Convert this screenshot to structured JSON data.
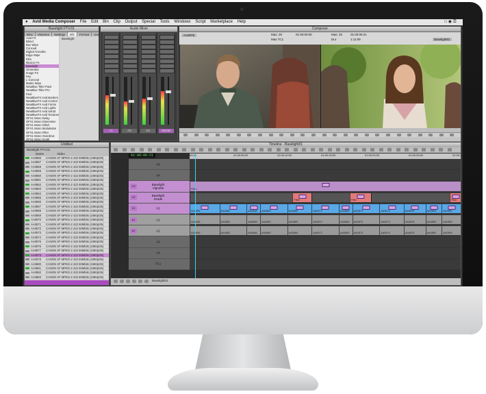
{
  "menubar": {
    "apple": "",
    "app": "Avid Media Composer",
    "items": [
      "File",
      "Edit",
      "Bin",
      "Clip",
      "Output",
      "Special",
      "Tools",
      "Windows",
      "Script",
      "Marketplace",
      "Help"
    ]
  },
  "effect_palette": {
    "title": "Baselight FTV.01",
    "tabs": [
      "Bins",
      "Volumes",
      "Settings",
      "Efx",
      "Format",
      "Usage",
      "Info"
    ],
    "active_tab": "Efx",
    "categories": [
      "Avid FX",
      "Blend",
      "Box Wipe",
      "Conceal",
      "Digital Arenafec",
      "Edge Wipe",
      "Film",
      "Illusion FX",
      "Baselight",
      "Generator",
      "Image FX",
      "Key",
      "L-Conceal",
      "Matrix Wipe",
      "NewBlue Titler Pack",
      "NewBlue Titler Pro",
      "Peel",
      "NewBlueFX Avid Borders",
      "NewBlueFX Avid Control",
      "NewBlueFX Avid Forms",
      "NewBlueFX Avid Lights",
      "NewBlueFX Avid Sarsd",
      "NewBlueFX Avid Textures",
      "OFX1 Mono Delay",
      "OFX1 Mono Dimension",
      "OFX1 Mono Glitch",
      "OFX1 Mono Modulation",
      "OFX1 Mono Filter",
      "OFX1 Mono Overdrive",
      "OFX1 Mono Synth"
    ],
    "selected_index": 8,
    "detail_item": "Baselight"
  },
  "audio_mixer": {
    "title": "Audio Mixer",
    "channels": [
      {
        "label": "A1",
        "level": 0.62,
        "highlight": true
      },
      {
        "label": "A2",
        "level": 0.48,
        "highlight": false
      },
      {
        "label": "A3",
        "level": 0.55,
        "highlight": false
      },
      {
        "label": "Master",
        "level": 0.7,
        "highlight": true
      }
    ],
    "top_value": "-INF"
  },
  "composer": {
    "title": "Composer",
    "source_clip": "AA0878",
    "mas_label": "Mas",
    "mas_value": "25",
    "tc_label": "Abs",
    "tc_value": "01:00:06:21",
    "mas_tc": "Mas TC1",
    "mas_tc2": "01:00:00:00",
    "dur_label": "Dur",
    "dur_value": "1:11:09",
    "record_seq": "Baselight01"
  },
  "bin": {
    "title": "Untitled",
    "sub_title": "Baselight FTV.01",
    "columns": [
      "Name",
      "Video"
    ],
    "rows": [
      {
        "name": "AA0856",
        "video": "CANON XF MPEG-2 422 50Mbits (1080p/25)",
        "icon": "green"
      },
      {
        "name": "AA0857",
        "video": "CANON XF MPEG-2 422 50Mbits (1080p/25)",
        "icon": "grey"
      },
      {
        "name": "AA0858",
        "video": "CANON XF MPEG-2 422 50Mbits (1080p/25)",
        "icon": "grey"
      },
      {
        "name": "AA0859",
        "video": "CANON XF MPEG-2 422 50Mbits (1080p/25)",
        "icon": "green"
      },
      {
        "name": "AA0860",
        "video": "CANON XF MPEG-2 422 50Mbits (1080p/25)",
        "icon": "grey"
      },
      {
        "name": "AA0861",
        "video": "CANON XF MPEG-2 422 50Mbits (1080p/25)",
        "icon": "grey"
      },
      {
        "name": "AA0862",
        "video": "CANON XF MPEG-2 422 50Mbits (1080p/25)",
        "icon": "green"
      },
      {
        "name": "AA0863",
        "video": "CANON XF MPEG-2 422 50Mbits (1080p/25)",
        "icon": "grey"
      },
      {
        "name": "AA0864",
        "video": "CANON XF MPEG-2 422 50Mbits (1080p/25)",
        "icon": "green"
      },
      {
        "name": "AA0865",
        "video": "CANON XF MPEG-2 422 50Mbits (1080p/25)",
        "icon": "grey"
      },
      {
        "name": "AA0866",
        "video": "CANON XF MPEG-2 422 50Mbits (1080p/25)",
        "icon": "grey"
      },
      {
        "name": "AA0867",
        "video": "CANON XF MPEG-2 422 50Mbits (1080p/25)",
        "icon": "green"
      },
      {
        "name": "AA0868",
        "video": "CANON XF MPEG-2 422 50Mbits (1080p/25)",
        "icon": "grey"
      },
      {
        "name": "AA0869",
        "video": "CANON XF MPEG-2 422 50Mbits (1080p/25)",
        "icon": "grey"
      },
      {
        "name": "AA0870",
        "video": "CANON XF MPEG-2 422 50Mbits (1080p/25)",
        "icon": "green"
      },
      {
        "name": "AA0871",
        "video": "CANON XF MPEG-2 422 50Mbits (1080p/25)",
        "icon": "grey"
      },
      {
        "name": "AA0872",
        "video": "CANON XF MPEG-2 422 50Mbits (1080p/25)",
        "icon": "grey"
      },
      {
        "name": "AA0873",
        "video": "CANON XF MPEG-2 422 50Mbits (1080p/25)",
        "icon": "green"
      },
      {
        "name": "AA0874",
        "video": "CANON XF MPEG-2 422 50Mbits (1080p/25)",
        "icon": "grey"
      },
      {
        "name": "AA0875",
        "video": "CANON XF MPEG-2 422 50Mbits (1080p/25)",
        "icon": "grey"
      },
      {
        "name": "AA0876",
        "video": "CANON XF MPEG-2 422 50Mbits (1080p/25)",
        "icon": "green"
      },
      {
        "name": "AA0877",
        "video": "CANON XF MPEG-2 422 50Mbits (1080p/25)",
        "icon": "grey"
      },
      {
        "name": "AA0878",
        "video": "CANON XF MPEG-2 422 50Mbits (1080p/25)",
        "icon": "green",
        "selected": true
      },
      {
        "name": "AA0879",
        "video": "CANON XF MPEG-2 422 50Mbits (1080p/25)",
        "icon": "grey"
      },
      {
        "name": "AA0880",
        "video": "CANON XF MPEG-2 422 50Mbits (1080p/25)",
        "icon": "grey"
      },
      {
        "name": "AA0881",
        "video": "CANON XF MPEG-2 422 50Mbits (1080p/25)",
        "icon": "green"
      },
      {
        "name": "AA0882",
        "video": "CANON XF MPEG-2 422 50Mbits (1080p/25)",
        "icon": "grey"
      },
      {
        "name": "AA0883",
        "video": "CANON XF MPEG-2 422 50Mbits (1080p/25)",
        "icon": "grey"
      },
      {
        "name": "AA0884",
        "video": "CANON XF MPEG-2 422 50Mbits (1080p/25)",
        "icon": "green"
      },
      {
        "name": "AA0885",
        "video": "CANON XF MPEG-2 422 50Mbits (1080p/25)",
        "icon": "grey"
      }
    ]
  },
  "timeline": {
    "title": "Timeline - Baselight01",
    "timecode": "01:00:06:21",
    "ruler": [
      "00:00",
      "01:00:05:00",
      "01:00:10:00",
      "01:00:15:00",
      "01:00:20:00",
      "01:00:25:00",
      "01:00:30:00"
    ],
    "footer_label": "Baselight01",
    "tracks": [
      {
        "name": "V5",
        "patch": "",
        "kind": "empty"
      },
      {
        "name": "V4",
        "patch": "",
        "kind": "empty"
      },
      {
        "name": "Baselight Vignette",
        "patch": "V3",
        "kind": "filter",
        "segments": [
          {
            "label": "Filter",
            "start": 0,
            "width": 1,
            "color": "#b88fc7"
          }
        ]
      },
      {
        "name": "Baselight Grade",
        "patch": "V2",
        "kind": "filter",
        "segments": [
          {
            "label": "",
            "start": 0,
            "width": 0.38,
            "color": "#555555"
          },
          {
            "label": "Filter",
            "start": 0.38,
            "width": 0.07,
            "color": "#e27a7a"
          },
          {
            "label": "",
            "start": 0.45,
            "width": 0.14,
            "color": "#555555"
          },
          {
            "label": "Filter",
            "start": 0.59,
            "width": 0.08,
            "color": "#e27a7a"
          },
          {
            "label": "",
            "start": 0.67,
            "width": 0.29,
            "color": "#555555"
          },
          {
            "label": "Filter",
            "start": 0.96,
            "width": 0.04,
            "color": "#e27a7a"
          }
        ]
      },
      {
        "name": "V1",
        "patch": "V1",
        "kind": "video",
        "segments": [
          {
            "label": "AA0856",
            "start": 0,
            "width": 0.11
          },
          {
            "label": "AA0882",
            "start": 0.11,
            "width": 0.1
          },
          {
            "label": "AA0864",
            "start": 0.21,
            "width": 0.05
          },
          {
            "label": "AA0865",
            "start": 0.26,
            "width": 0.1
          },
          {
            "label": "AA0869",
            "start": 0.36,
            "width": 0.09
          },
          {
            "label": "AA0872",
            "start": 0.45,
            "width": 0.1
          },
          {
            "label": "AA0883",
            "start": 0.55,
            "width": 0.05
          },
          {
            "label": "AA0873",
            "start": 0.6,
            "width": 0.1
          },
          {
            "label": "AA0874",
            "start": 0.7,
            "width": 0.09
          },
          {
            "label": "AA0878",
            "start": 0.79,
            "width": 0.08
          },
          {
            "label": "AA0853",
            "start": 0.87,
            "width": 0.06
          },
          {
            "label": "AA0894",
            "start": 0.93,
            "width": 0.07
          }
        ]
      },
      {
        "name": "A1",
        "patch": "A1",
        "kind": "audio",
        "segments": [
          {
            "label": "AA0856",
            "start": 0,
            "width": 0.11
          },
          {
            "label": "AA0882",
            "start": 0.11,
            "width": 0.1
          },
          {
            "label": "AA0864",
            "start": 0.21,
            "width": 0.05
          },
          {
            "label": "AA0865",
            "start": 0.26,
            "width": 0.1
          },
          {
            "label": "AA0869",
            "start": 0.36,
            "width": 0.09
          },
          {
            "label": "AA0872",
            "start": 0.45,
            "width": 0.1
          },
          {
            "label": "AA0883",
            "start": 0.55,
            "width": 0.05
          },
          {
            "label": "AA0873",
            "start": 0.6,
            "width": 0.1
          },
          {
            "label": "AA0874",
            "start": 0.7,
            "width": 0.09
          },
          {
            "label": "AA0878",
            "start": 0.79,
            "width": 0.08
          },
          {
            "label": "AA0853",
            "start": 0.87,
            "width": 0.06
          },
          {
            "label": "AA0894",
            "start": 0.93,
            "width": 0.07
          }
        ]
      },
      {
        "name": "A2",
        "patch": "A2",
        "kind": "audio",
        "segments": [
          {
            "label": "AA0856",
            "start": 0,
            "width": 0.11
          },
          {
            "label": "AA0882",
            "start": 0.11,
            "width": 0.1
          },
          {
            "label": "AA0864",
            "start": 0.21,
            "width": 0.05
          },
          {
            "label": "AA0865",
            "start": 0.26,
            "width": 0.1
          },
          {
            "label": "AA0869",
            "start": 0.36,
            "width": 0.09
          },
          {
            "label": "AA0872",
            "start": 0.45,
            "width": 0.1
          },
          {
            "label": "AA0883",
            "start": 0.55,
            "width": 0.05
          },
          {
            "label": "AA0873",
            "start": 0.6,
            "width": 0.1
          },
          {
            "label": "AA0874",
            "start": 0.7,
            "width": 0.09
          },
          {
            "label": "AA0878",
            "start": 0.79,
            "width": 0.08
          },
          {
            "label": "AA0853",
            "start": 0.87,
            "width": 0.06
          },
          {
            "label": "AA0894",
            "start": 0.93,
            "width": 0.07
          }
        ]
      },
      {
        "name": "A3",
        "patch": "",
        "kind": "empty"
      },
      {
        "name": "A4",
        "patch": "",
        "kind": "empty"
      },
      {
        "name": "TC1",
        "patch": "",
        "kind": "empty"
      }
    ]
  },
  "colors": {
    "accent": "#a84cbf",
    "video_clip": "#5aa8e6",
    "audio_clip": "#9a9a9a",
    "filter": "#e27a7a"
  }
}
